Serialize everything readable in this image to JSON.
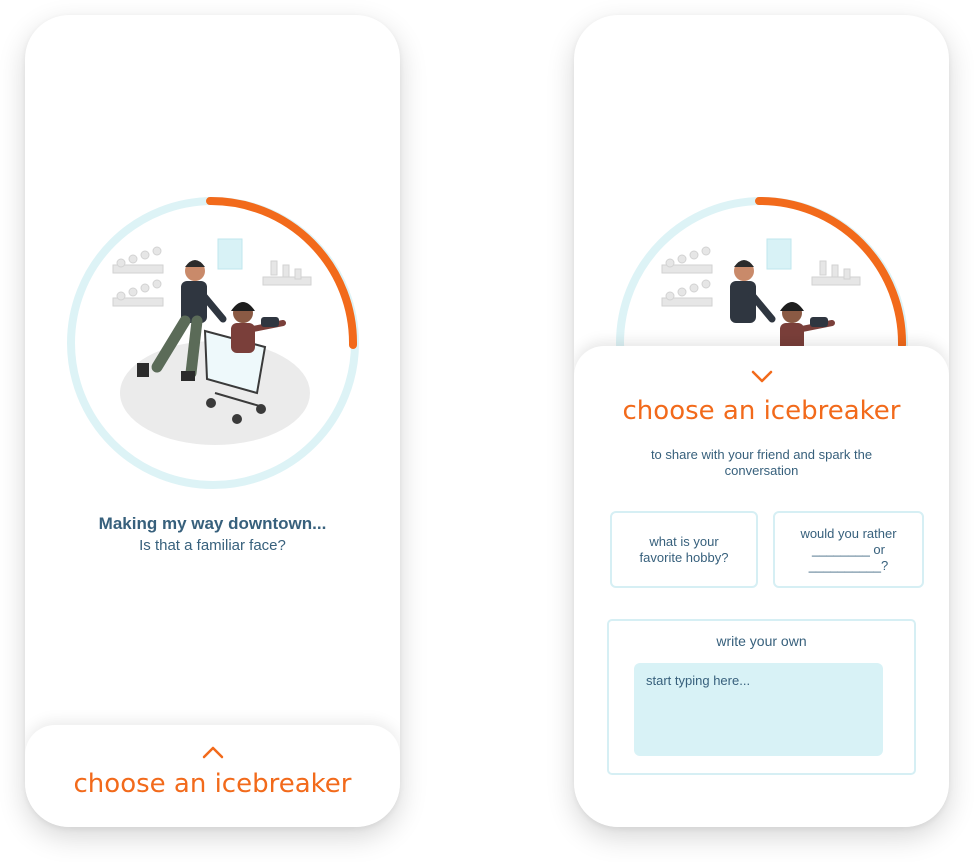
{
  "left_screen": {
    "status_title": "Making my way downtown...",
    "status_subtitle": "Is that a familiar face?",
    "progress_fraction": 0.25,
    "sheet_chevron_icon": "chevron-up-icon",
    "sheet_title": "choose an icebreaker"
  },
  "right_screen": {
    "progress_fraction": 0.25,
    "sheet_chevron_icon": "chevron-down-icon",
    "sheet_title": "choose an icebreaker",
    "sheet_description": "to share with your friend and spark the conversation",
    "icebreakers": [
      {
        "text": "what is your favorite hobby?"
      },
      {
        "line1": "would you rather",
        "line2": "________ or",
        "line3": "__________?"
      }
    ],
    "write_own_label": "write your own",
    "input_placeholder": "start typing here..."
  },
  "colors": {
    "accent_orange": "#f26a1b",
    "text_blue": "#37607c",
    "ring_light": "#ddf3f6",
    "input_bg": "#d8f2f6"
  }
}
